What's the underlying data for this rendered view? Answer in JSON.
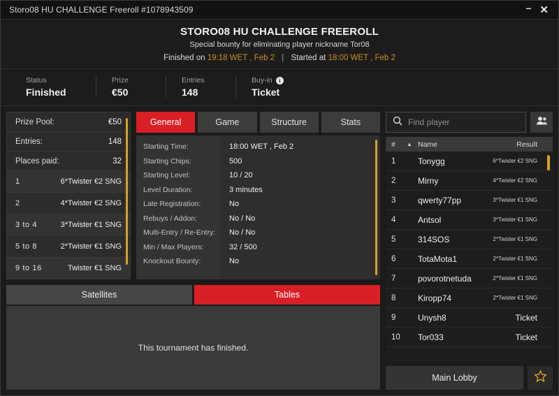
{
  "window": {
    "title": "Storo08 HU CHALLENGE Freeroll #1078943509",
    "minimize_label": "–",
    "close_label": "✕"
  },
  "header": {
    "title": "STORO08 HU CHALLENGE FREEROLL",
    "subtitle": "Special bounty for eliminating player nickname Tor08",
    "finished_prefix": "Finished on",
    "finished_time": "19:18 WET , Feb 2",
    "separator": "|",
    "started_prefix": "Started at",
    "started_time": "18:00 WET , Feb 2",
    "accent_color": "#c98f24"
  },
  "status": [
    {
      "label": "Status",
      "value": "Finished",
      "info": false
    },
    {
      "label": "Prize",
      "value": "€50",
      "info": false
    },
    {
      "label": "Entries",
      "value": "148",
      "info": false
    },
    {
      "label": "Buy-in",
      "value": "Ticket",
      "info": true,
      "info_glyph": "i"
    }
  ],
  "prize_panel": {
    "summary": [
      {
        "label": "Prize Pool:",
        "value": "€50"
      },
      {
        "label": "Entries:",
        "value": "148"
      },
      {
        "label": "Places paid:",
        "value": "32"
      }
    ],
    "payouts": [
      {
        "place": "1",
        "prize": "6*Twister €2 SNG"
      },
      {
        "place": "2",
        "prize": "4*Twister €2 SNG"
      },
      {
        "place": "3  to  4",
        "prize": "3*Twister €1 SNG"
      },
      {
        "place": "5  to  8",
        "prize": "2*Twister €1 SNG"
      },
      {
        "place": "9  to  16",
        "prize": "Twister €1 SNG"
      }
    ]
  },
  "tabs": {
    "items": [
      {
        "label": "General",
        "active": true
      },
      {
        "label": "Game",
        "active": false
      },
      {
        "label": "Structure",
        "active": false
      },
      {
        "label": "Stats",
        "active": false
      }
    ],
    "active_color": "#d91f26"
  },
  "general": {
    "rows": [
      {
        "label": "Starting Time:",
        "value": "18:00 WET , Feb 2"
      },
      {
        "label": "Starting Chips:",
        "value": "500"
      },
      {
        "label": "Starting Level:",
        "value": "10 / 20"
      },
      {
        "label": "Level Duration:",
        "value": "3 minutes"
      },
      {
        "label": "Late Registration:",
        "value": "No"
      },
      {
        "label": "Rebuys / Addon:",
        "value": "No / No"
      },
      {
        "label": "Multi-Entry / Re-Entry:",
        "value": "No / No"
      },
      {
        "label": "Min / Max Players:",
        "value": "32 / 500"
      },
      {
        "label": "Knockout Bounty:",
        "value": "No"
      }
    ]
  },
  "sub_tabs": {
    "items": [
      {
        "label": "Satellites",
        "active": false
      },
      {
        "label": "Tables",
        "active": true
      }
    ],
    "message": "This tournament has finished."
  },
  "search": {
    "placeholder": "Find player",
    "value": "",
    "icon": "search-icon",
    "people_icon": "people-icon"
  },
  "players": {
    "columns": {
      "num": "#",
      "sort": "▲",
      "name": "Name",
      "result": "Result"
    },
    "rows": [
      {
        "num": "1",
        "name": "Tonygg",
        "result": "6*Twister €2 SNG",
        "ticket": false
      },
      {
        "num": "2",
        "name": "Mirny",
        "result": "4*Twister €2 SNG",
        "ticket": false
      },
      {
        "num": "3",
        "name": "qwerty77pp",
        "result": "3*Twister €1 SNG",
        "ticket": false
      },
      {
        "num": "4",
        "name": "Antsol",
        "result": "3*Twister €1 SNG",
        "ticket": false
      },
      {
        "num": "5",
        "name": "314SOS",
        "result": "2*Twister €1 SNG",
        "ticket": false
      },
      {
        "num": "6",
        "name": "TotaMota1",
        "result": "2*Twister €1 SNG",
        "ticket": false
      },
      {
        "num": "7",
        "name": "povorotnetuda",
        "result": "2*Twister €1 SNG",
        "ticket": false
      },
      {
        "num": "8",
        "name": "Kiropp74",
        "result": "2*Twister €1 SNG",
        "ticket": false
      },
      {
        "num": "9",
        "name": "Unysh8",
        "result": "Ticket",
        "ticket": true
      },
      {
        "num": "10",
        "name": "Tor033",
        "result": "Ticket",
        "ticket": true
      }
    ]
  },
  "footer": {
    "main_lobby_label": "Main Lobby",
    "favourite_icon": "star-icon",
    "favourite_color": "#d8a126"
  }
}
